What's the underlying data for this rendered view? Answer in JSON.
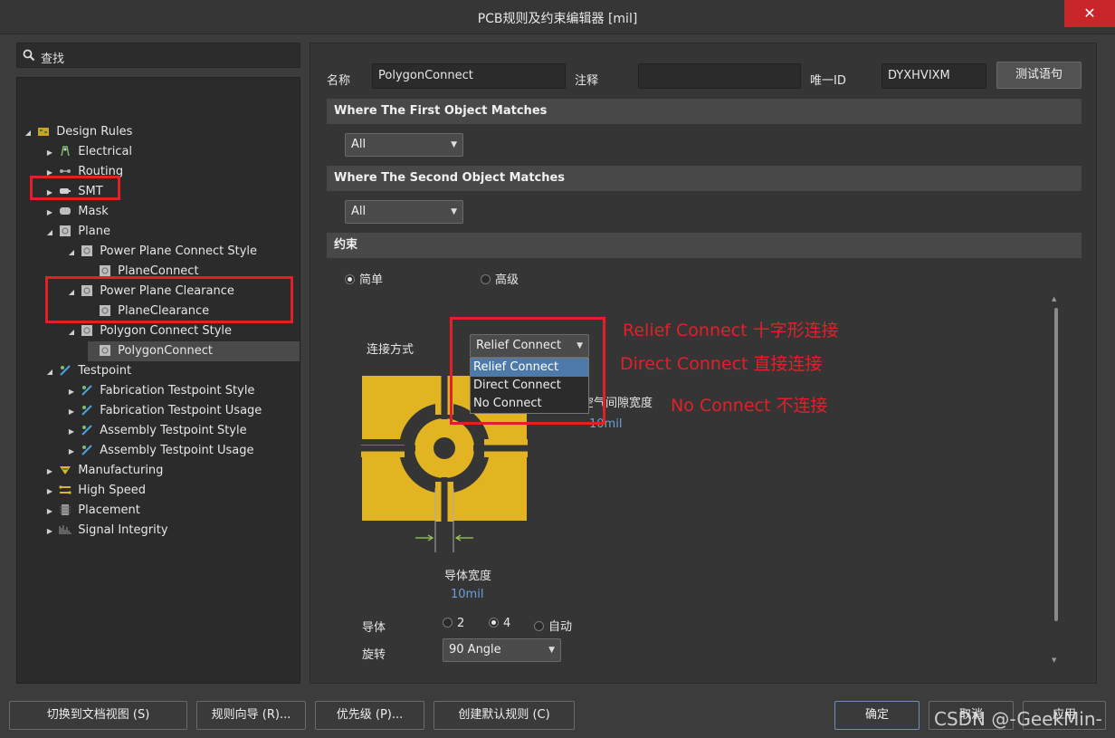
{
  "window": {
    "title": "PCB规则及约束编辑器 [mil]",
    "close_glyph": "✕"
  },
  "search": {
    "placeholder": "查找"
  },
  "tree": {
    "root": "Design Rules",
    "items": [
      {
        "label": "Electrical",
        "icon": "electrical-icon"
      },
      {
        "label": "Routing",
        "icon": "routing-icon"
      },
      {
        "label": "SMT",
        "icon": "smt-icon"
      },
      {
        "label": "Mask",
        "icon": "mask-icon"
      },
      {
        "label": "Plane",
        "icon": "plane-icon"
      },
      {
        "label": "Power Plane Connect Style",
        "icon": "rule-category-icon"
      },
      {
        "label": "PlaneConnect",
        "icon": "rule-icon"
      },
      {
        "label": "Power Plane Clearance",
        "icon": "rule-category-icon"
      },
      {
        "label": "PlaneClearance",
        "icon": "rule-icon"
      },
      {
        "label": "Polygon Connect Style",
        "icon": "rule-category-icon"
      },
      {
        "label": "PolygonConnect",
        "icon": "rule-icon"
      },
      {
        "label": "Testpoint",
        "icon": "testpoint-icon"
      },
      {
        "label": "Fabrication Testpoint Style",
        "icon": "testpoint-icon"
      },
      {
        "label": "Fabrication Testpoint Usage",
        "icon": "testpoint-icon"
      },
      {
        "label": "Assembly Testpoint Style",
        "icon": "testpoint-icon"
      },
      {
        "label": "Assembly Testpoint Usage",
        "icon": "testpoint-icon"
      },
      {
        "label": "Manufacturing",
        "icon": "manufacturing-icon"
      },
      {
        "label": "High Speed",
        "icon": "high-speed-icon"
      },
      {
        "label": "Placement",
        "icon": "placement-icon"
      },
      {
        "label": "Signal Integrity",
        "icon": "signal-integrity-icon"
      }
    ]
  },
  "rule": {
    "name_label": "名称",
    "name_value": "PolygonConnect",
    "comment_label": "注释",
    "comment_value": "",
    "id_label": "唯一ID",
    "id_value": "DYXHVIXM",
    "test_button": "测试语句"
  },
  "first_match": {
    "header": "Where The First Object Matches",
    "value": "All"
  },
  "second_match": {
    "header": "Where The Second Object Matches",
    "value": "All"
  },
  "constraints": {
    "header": "约束",
    "mode_simple": "简单",
    "mode_advanced": "高级",
    "connect_label": "连接方式",
    "connect_value": "Relief Connect",
    "options": [
      "Relief Connect",
      "Direct Connect",
      "No Connect"
    ],
    "air_gap_label": "空气间隙宽度",
    "air_gap_value": "10mil",
    "conductor_width_label": "导体宽度",
    "conductor_width_value": "10mil",
    "conductors_label": "导体",
    "conductors_opt_2": "2",
    "conductors_opt_4": "4",
    "conductors_opt_auto": "自动",
    "rotation_label": "旋转",
    "rotation_value": "90 Angle"
  },
  "annotations": {
    "relief": "Relief Connect 十字形连接",
    "direct": "Direct Connect 直接连接",
    "none": "No Connect 不连接"
  },
  "bottom": {
    "switch_doc_view": "切换到文档视图 (S)",
    "rule_wizard": "规则向导 (R)...",
    "priority": "优先级 (P)...",
    "create_default": "创建默认规则 (C)",
    "ok": "确定",
    "cancel": "取消",
    "apply": "应用"
  },
  "watermark": "CSDN @-GeekMin-",
  "colors": {
    "accent_red": "#e3202a",
    "pad_yellow": "#e3b422",
    "selection_blue": "#4d7aa8",
    "value_blue": "#6aa2dc"
  }
}
